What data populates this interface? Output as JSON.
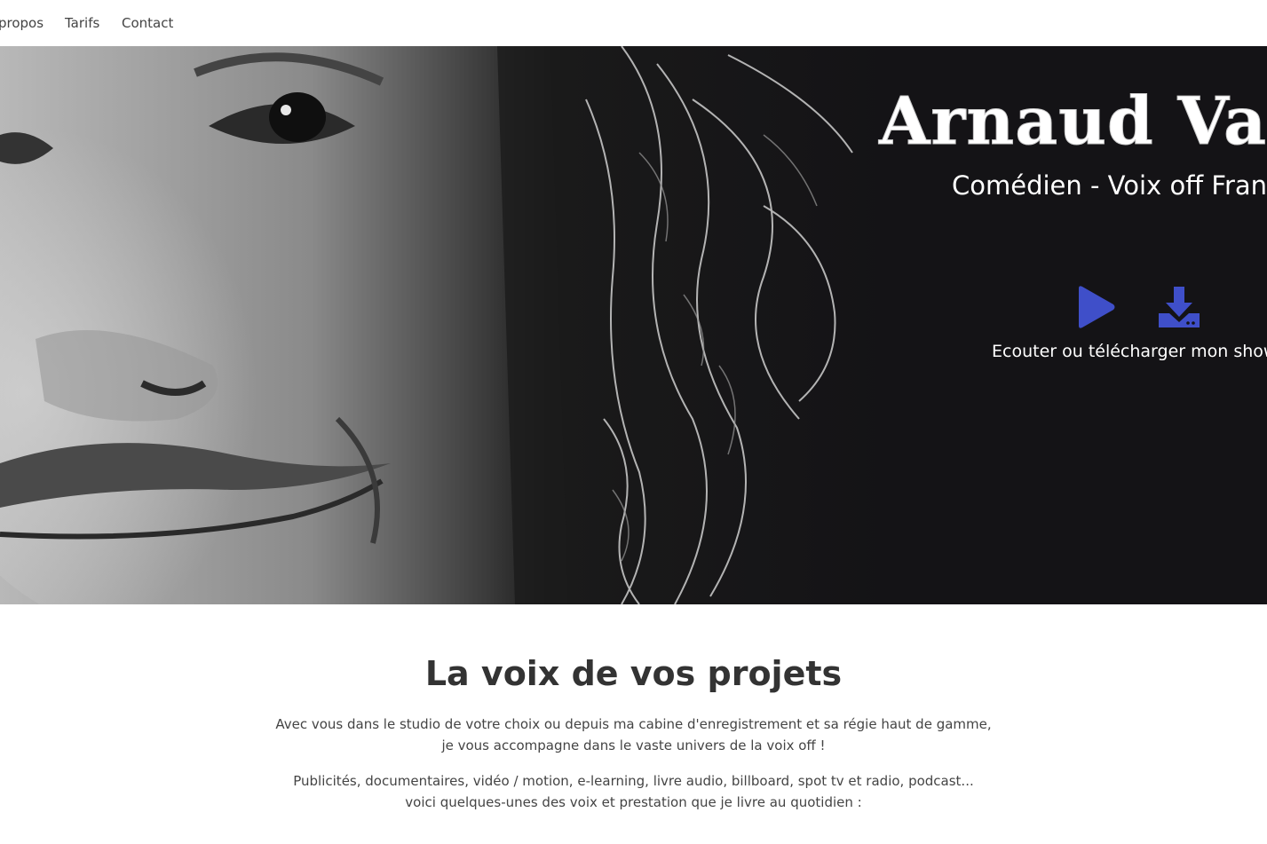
{
  "nav": {
    "items": [
      {
        "label": "propos"
      },
      {
        "label": "Tarifs"
      },
      {
        "label": "Contact"
      }
    ]
  },
  "hero": {
    "title": "Arnaud Vale",
    "subtitle": "Comédien - Voix off Franc",
    "play_icon": "play-icon",
    "download_icon": "download-icon",
    "cta": "Ecouter ou télécharger mon showre",
    "accent_color": "#3f4fc9"
  },
  "intro": {
    "heading": "La voix de vos projets",
    "paragraph1_line1": "Avec vous dans le studio de votre choix ou depuis ma cabine d'enregistrement et sa régie haut de gamme,",
    "paragraph1_line2": "je vous accompagne dans le vaste univers de la voix off !",
    "paragraph2_line1": "Publicités, documentaires, vidéo / motion, e-learning, livre audio, billboard, spot tv et radio, podcast...",
    "paragraph2_line2": "voici quelques-unes des voix et prestation que je livre au quotidien :"
  }
}
